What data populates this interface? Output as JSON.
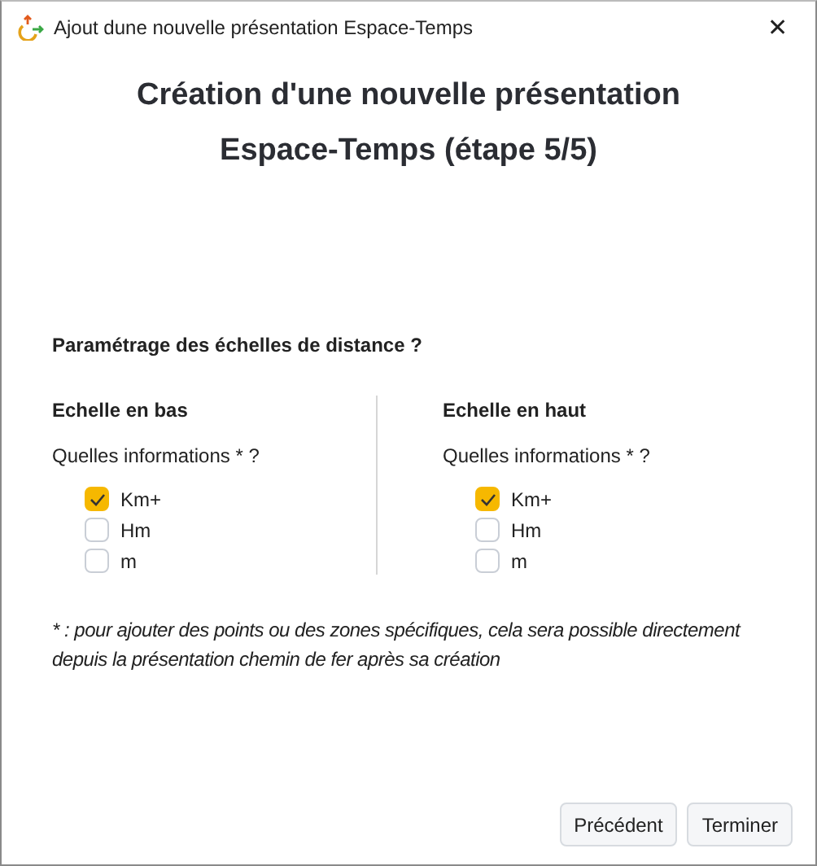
{
  "window": {
    "title": "Ajout dune nouvelle présentation Espace-Temps",
    "close": "✕"
  },
  "heading": [
    "Création d'une nouvelle présentation",
    "Espace-Temps (étape 5/5)"
  ],
  "section_label": "Paramétrage des échelles de distance ?",
  "columns": [
    {
      "title": "Echelle en bas",
      "question": "Quelles informations * ?",
      "options": [
        {
          "label": "Km+",
          "checked": true
        },
        {
          "label": "Hm",
          "checked": false
        },
        {
          "label": "m",
          "checked": false
        }
      ]
    },
    {
      "title": "Echelle en haut",
      "question": "Quelles informations * ?",
      "options": [
        {
          "label": "Km+",
          "checked": true
        },
        {
          "label": "Hm",
          "checked": false
        },
        {
          "label": "m",
          "checked": false
        }
      ]
    }
  ],
  "footnote": "* : pour ajouter des points ou des zones spécifiques, cela sera possible directement depuis la présentation chemin de fer après sa création",
  "buttons": [
    "Précédent",
    "Terminer"
  ]
}
